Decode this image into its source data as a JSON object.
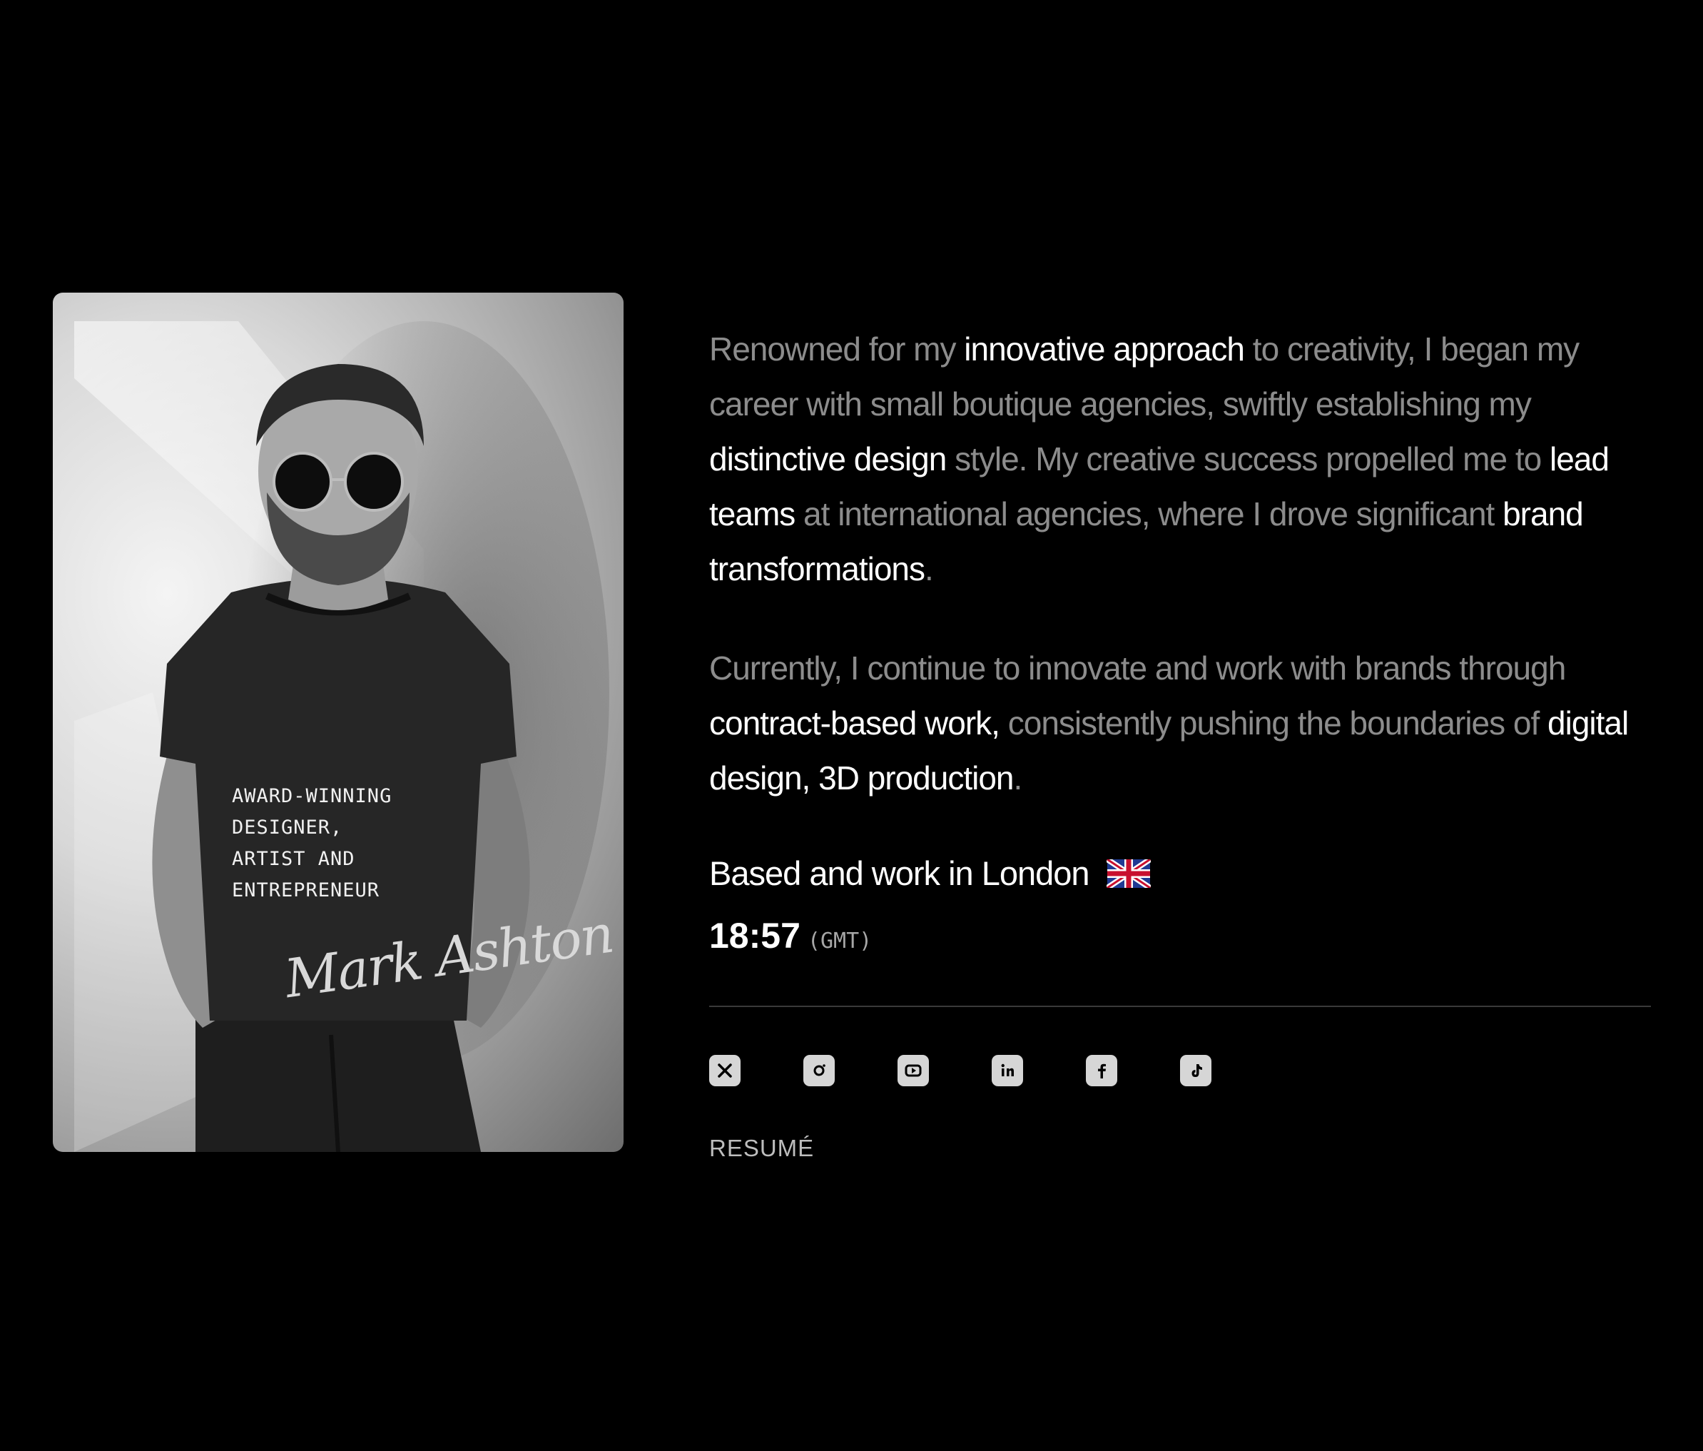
{
  "portrait": {
    "signature": "Mark Ashton",
    "tagline_lines": [
      "AWARD-WINNING",
      "DESIGNER,",
      "ARTIST AND",
      "ENTREPRENEUR"
    ]
  },
  "bio": {
    "p1": [
      {
        "text": "Renowned for my ",
        "hl": false
      },
      {
        "text": "innovative approach",
        "hl": true
      },
      {
        "text": " to creativity, I began my career with small boutique agencies, swiftly establishing my ",
        "hl": false
      },
      {
        "text": "distinctive design",
        "hl": true
      },
      {
        "text": " style. My creative success propelled me to ",
        "hl": false
      },
      {
        "text": "lead teams",
        "hl": true
      },
      {
        "text": " at international agencies, where I drove significant ",
        "hl": false
      },
      {
        "text": "brand transformations",
        "hl": true
      },
      {
        "text": ".",
        "hl": false
      }
    ],
    "p2": [
      {
        "text": "Currently, I continue to innovate and work with brands through ",
        "hl": false
      },
      {
        "text": "contract-based work,",
        "hl": true
      },
      {
        "text": " consistently pushing the boundaries of ",
        "hl": false
      },
      {
        "text": "digital design, 3D production",
        "hl": true
      },
      {
        "text": ".",
        "hl": false
      }
    ]
  },
  "location": {
    "text": "Based and work in London",
    "flag_icon": "uk-flag-icon"
  },
  "clock": {
    "time": "18:57",
    "timezone": "(GMT)"
  },
  "socials": [
    {
      "name": "x-icon"
    },
    {
      "name": "instagram-icon"
    },
    {
      "name": "youtube-icon"
    },
    {
      "name": "linkedin-icon"
    },
    {
      "name": "facebook-icon"
    },
    {
      "name": "tiktok-icon"
    }
  ],
  "resume_label": "RESUMÉ",
  "colors": {
    "background": "#000000",
    "text_dim": "#8c8c8c",
    "text_highlight": "#ffffff",
    "icon_fill": "#d6d6d6",
    "divider": "#3a3a3a"
  }
}
